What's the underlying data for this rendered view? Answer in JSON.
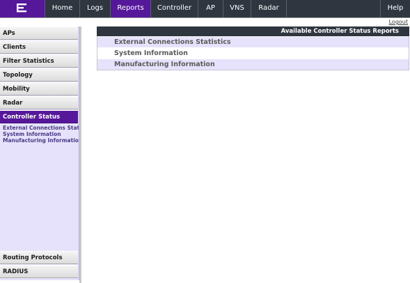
{
  "nav": {
    "tabs": [
      {
        "label": "Home"
      },
      {
        "label": "Logs"
      },
      {
        "label": "Reports"
      },
      {
        "label": "Controller"
      },
      {
        "label": "AP"
      },
      {
        "label": "VNS"
      },
      {
        "label": "Radar"
      }
    ],
    "help": "Help",
    "active_tab": "Reports",
    "logout": "Logout"
  },
  "sidebar": {
    "items": [
      {
        "label": "APs"
      },
      {
        "label": "Clients"
      },
      {
        "label": "Filter Statistics"
      },
      {
        "label": "Topology"
      },
      {
        "label": "Mobility"
      },
      {
        "label": "Radar"
      },
      {
        "label": "Controller Status"
      }
    ],
    "sublinks": [
      {
        "label": "External Connections Statistics"
      },
      {
        "label": "System Information"
      },
      {
        "label": "Manufacturing Information"
      }
    ],
    "bottom_items": [
      {
        "label": "Routing Protocols"
      },
      {
        "label": "RADIUS"
      }
    ]
  },
  "main": {
    "header": "Available Controller Status Reports",
    "reports": [
      {
        "label": "External Connections Statistics"
      },
      {
        "label": "System Information"
      },
      {
        "label": "Manufacturing Information"
      }
    ]
  },
  "colors": {
    "accent": "#56189a",
    "navbar": "#2f3640",
    "sidebar_bg": "#e6e2fb"
  }
}
